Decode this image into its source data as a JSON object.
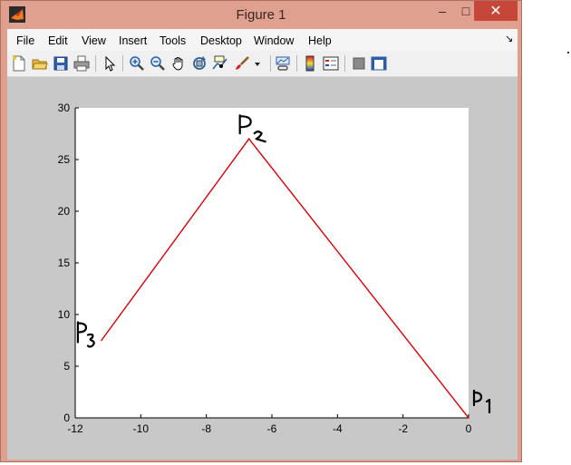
{
  "window": {
    "title": "Figure 1",
    "minimize_glyph": "–",
    "maximize_glyph": "□",
    "close_glyph": "✕"
  },
  "menu": {
    "items": [
      "File",
      "Edit",
      "View",
      "Insert",
      "Tools",
      "Desktop",
      "Window",
      "Help"
    ],
    "dock_arrow": "↘"
  },
  "toolbar": {
    "icons": [
      "new-figure-icon",
      "open-file-icon",
      "save-figure-icon",
      "print-figure-icon",
      "edit-plot-arrow-icon",
      "zoom-in-icon",
      "zoom-out-icon",
      "pan-hand-icon",
      "rotate-3d-icon",
      "data-cursor-icon",
      "brush-icon",
      "link-plot-icon",
      "insert-colorbar-icon",
      "insert-legend-icon",
      "hide-plot-tools-icon",
      "show-plot-tools-icon"
    ]
  },
  "colors": {
    "line": "#e00000",
    "figure_bg": "#c8c8c8",
    "axes_bg": "#ffffff"
  },
  "chart_data": {
    "type": "line",
    "x": [
      0,
      -6.7,
      -11.2
    ],
    "y": [
      0,
      27,
      7.5
    ],
    "xlim": [
      -12,
      0
    ],
    "ylim": [
      0,
      30
    ],
    "xticks": [
      -12,
      -10,
      -8,
      -6,
      -4,
      -2,
      0
    ],
    "yticks": [
      0,
      5,
      10,
      15,
      20,
      25,
      30
    ],
    "grid": false,
    "annotations": [
      {
        "text": "P1",
        "at": "point-0"
      },
      {
        "text": "P2",
        "at": "point-1"
      },
      {
        "text": "P3",
        "at": "point-2"
      }
    ]
  }
}
